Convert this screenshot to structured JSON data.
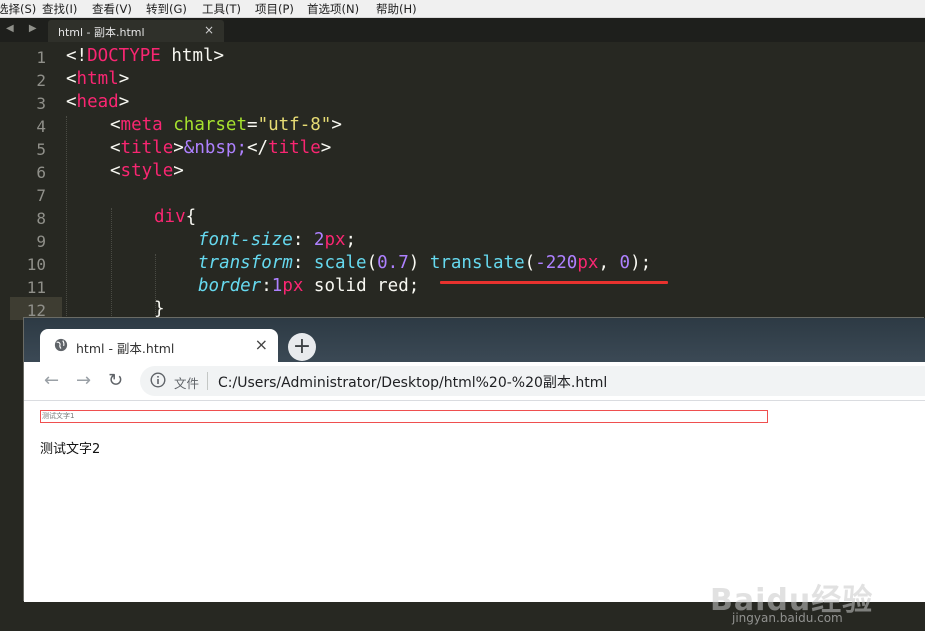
{
  "editor": {
    "menu": [
      "选择(S)",
      "查找(I)",
      "查看(V)",
      "转到(G)",
      "工具(T)",
      "项目(P)",
      "首选项(N)",
      "帮助(H)"
    ],
    "tab_title": "html - 副本.html",
    "tab_close": "×",
    "line_numbers": [
      "1",
      "2",
      "3",
      "4",
      "5",
      "6",
      "7",
      "8",
      "9",
      "10",
      "11",
      "12"
    ],
    "code": {
      "l1": {
        "lt": "<!",
        "doctype": "DOCTYPE",
        "rest": " html>"
      },
      "l2": {
        "lt": "<",
        "tag": "html",
        "gt": ">"
      },
      "l3": {
        "lt": "<",
        "tag": "head",
        "gt": ">"
      },
      "l4": {
        "lt": "<",
        "tag": "meta",
        "sp": " ",
        "attr": "charset",
        "eq": "=",
        "val": "\"utf-8\"",
        "gt": ">"
      },
      "l5": {
        "lt": "<",
        "tag": "title",
        "ent": "&nbsp;",
        "lt2": "</",
        "tag2": "title",
        "gt": ">"
      },
      "l6": {
        "lt": "<",
        "tag": "style",
        "gt": ">"
      },
      "l8": {
        "sel": "div",
        "brace": "{"
      },
      "l9": {
        "prop": "font-size",
        "colon": ": ",
        "num": "2",
        "unit": "px",
        "semi": ";"
      },
      "l10": {
        "prop": "transform",
        "colon": ": ",
        "f1": "scale",
        "p1": "(",
        "n1": "0.7",
        "p2": ") ",
        "f2": "translate",
        "p3": "(",
        "n2": "-220",
        "u2": "px",
        "comma": ", ",
        "n3": "0",
        "p4": ");"
      },
      "l11": {
        "prop": "border",
        "colon": ":",
        "num": "1",
        "unit": "px",
        "rest": " solid red;"
      },
      "l12": {
        "brace": "}"
      }
    }
  },
  "browser": {
    "tab_title": "html - 副本.html",
    "tab_close": "×",
    "new_tab": "+",
    "back_icon": "←",
    "forward_icon": "→",
    "reload_icon": "↻",
    "file_label": "文件",
    "url": "C:/Users/Administrator/Desktop/html%20-%20副本.html",
    "page": {
      "div_text": "测试文字1",
      "p_text": "测试文字2"
    }
  },
  "watermark": {
    "brand": "Baidu经验",
    "sub": "jingyan.baidu.com"
  },
  "colors": {
    "editor_bg": "#272822",
    "keyword": "#f92672",
    "string": "#e6db74",
    "attribute": "#a6e22e",
    "number": "#ae81ff",
    "property": "#66d9ef",
    "underline": "#e8322e",
    "border_red": "#ef4f4f"
  }
}
